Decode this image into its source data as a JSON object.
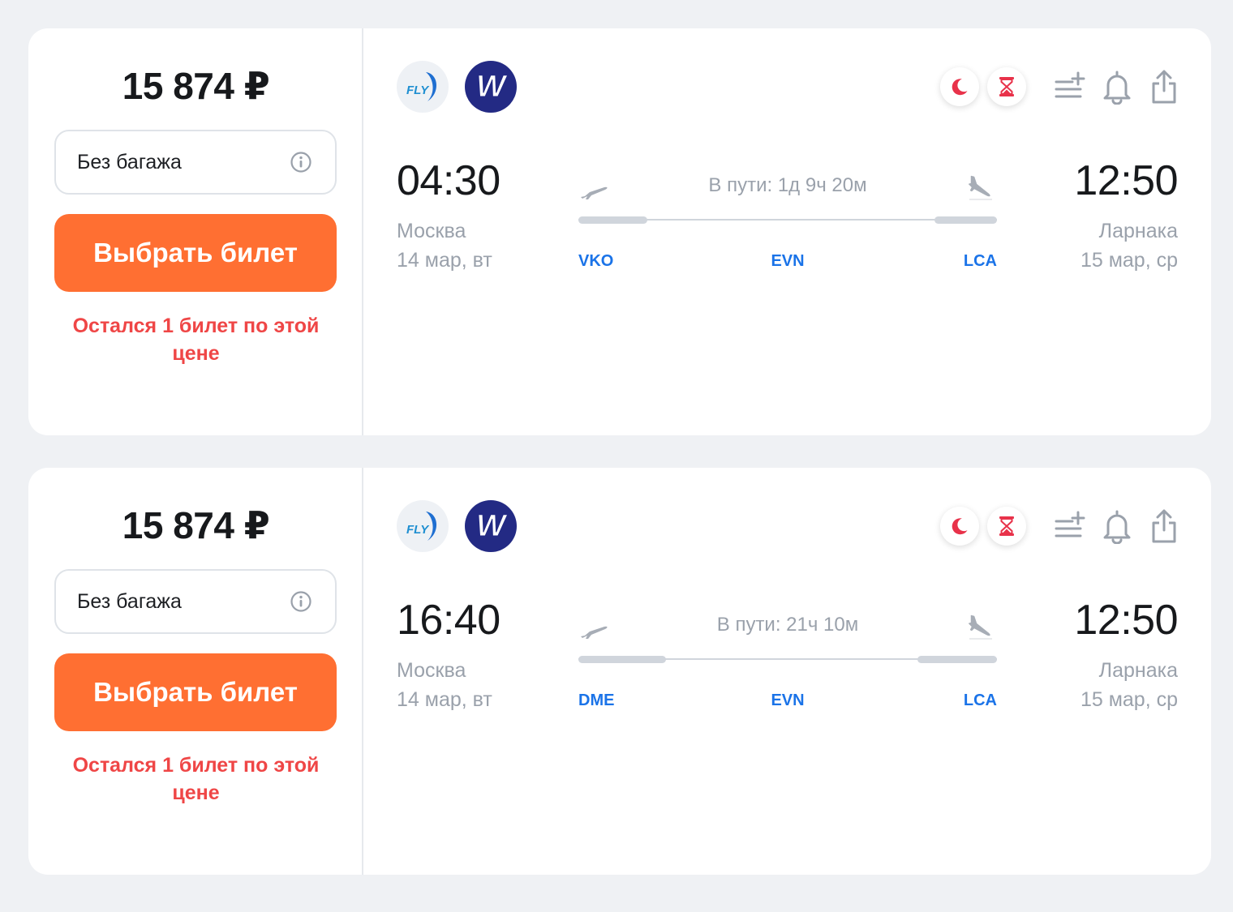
{
  "colors": {
    "accent_button": "#ff6f32",
    "warning_text": "#ef4646",
    "airport_code": "#1a73e8",
    "night_badge": "#e8324a",
    "background": "#eff1f4"
  },
  "icons": [
    "info-icon",
    "moon-icon",
    "hourglass-icon",
    "add-to-list-icon",
    "bell-icon",
    "share-icon",
    "takeoff-plane-icon",
    "landing-plane-icon"
  ],
  "tickets": [
    {
      "price": "15 874 ₽",
      "baggage": "Без багажа",
      "choose_label": "Выбрать билет",
      "warning": "Остался 1 билет по этой цене",
      "airlines": [
        {
          "logo_text": "FLY",
          "icon": "fly-logo"
        },
        {
          "logo_text": "W",
          "icon": "w-logo"
        }
      ],
      "departure": {
        "time": "04:30",
        "city": "Москва",
        "date": "14 мар, вт",
        "code": "VKO"
      },
      "arrival": {
        "time": "12:50",
        "city": "Ларнака",
        "date": "15 мар, ср",
        "code": "LCA"
      },
      "stop_code": "EVN",
      "duration": "В пути: 1д 9ч 20м"
    },
    {
      "price": "15 874 ₽",
      "baggage": "Без багажа",
      "choose_label": "Выбрать билет",
      "warning": "Остался 1 билет по этой цене",
      "airlines": [
        {
          "logo_text": "FLY",
          "icon": "fly-logo"
        },
        {
          "logo_text": "W",
          "icon": "w-logo"
        }
      ],
      "departure": {
        "time": "16:40",
        "city": "Москва",
        "date": "14 мар, вт",
        "code": "DME"
      },
      "arrival": {
        "time": "12:50",
        "city": "Ларнака",
        "date": "15 мар, ср",
        "code": "LCA"
      },
      "stop_code": "EVN",
      "duration": "В пути: 21ч 10м"
    }
  ]
}
